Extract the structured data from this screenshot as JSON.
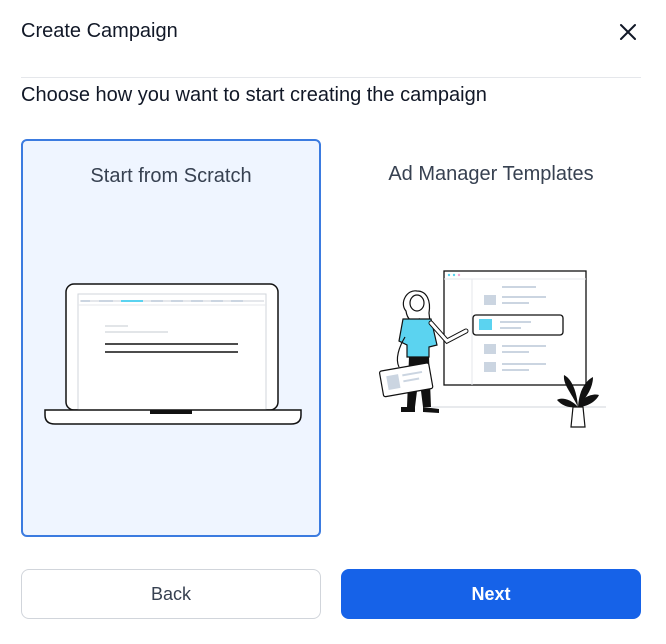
{
  "dialog": {
    "title": "Create Campaign",
    "subtitle": "Choose how you want to start creating the campaign"
  },
  "options": [
    {
      "label": "Start from Scratch",
      "selected": true
    },
    {
      "label": "Ad Manager Templates",
      "selected": false
    }
  ],
  "actions": {
    "back_label": "Back",
    "next_label": "Next"
  },
  "colors": {
    "primary": "#1662e8",
    "selected_border": "#3b7be0",
    "selected_bg": "#eff5ff",
    "illustration_accent": "#5bd3f0"
  },
  "icons": {
    "close": "close-icon",
    "scratch": "laptop-illustration",
    "templates": "woman-presenting-templates-illustration"
  }
}
